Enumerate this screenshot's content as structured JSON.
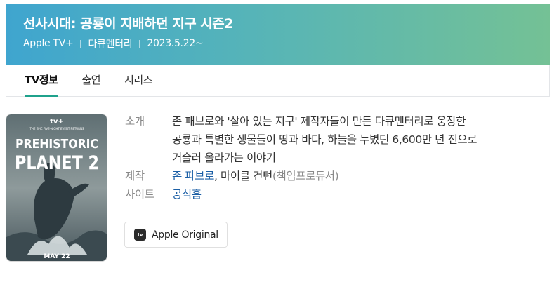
{
  "header": {
    "title": "선사시대: 공룡이 지배하던 지구 시즌2",
    "meta": [
      "Apple TV+",
      "다큐멘터리",
      "2023.5.22~"
    ]
  },
  "tabs": [
    {
      "label": "TV정보",
      "active": true
    },
    {
      "label": "출연",
      "active": false
    },
    {
      "label": "시리즈",
      "active": false
    }
  ],
  "poster": {
    "brand": "tv+",
    "tagline": "THE EPIC FIVE-NIGHT EVENT RETURNS",
    "title_line1": "PREHISTORIC",
    "title_line2": "PLANET 2",
    "date": "MAY 22"
  },
  "info": {
    "intro_label": "소개",
    "intro_line1": "존 패브로와 '살아 있는 지구' 제작자들이 만든 다큐멘터리로 웅장한",
    "intro_line2": "공룡과 특별한 생물들이 땅과 바다, 하늘을 누볐던 6,600만 년 전으로",
    "intro_line3": "거슬러 올라가는 이야기",
    "production_label": "제작",
    "producer1": "존 파브로",
    "comma": ",",
    "producer2": "마이클 건턴",
    "producer2_role": "(책임프로듀서)",
    "site_label": "사이트",
    "site_link": "공식홈"
  },
  "badge": {
    "icon_text": "tv",
    "label": "Apple Original"
  },
  "colors": {
    "header_gradient_start": "#3fa5cf",
    "header_gradient_end": "#74c195",
    "tab_underline": "#1fa28c",
    "link": "#1a5ea5"
  }
}
